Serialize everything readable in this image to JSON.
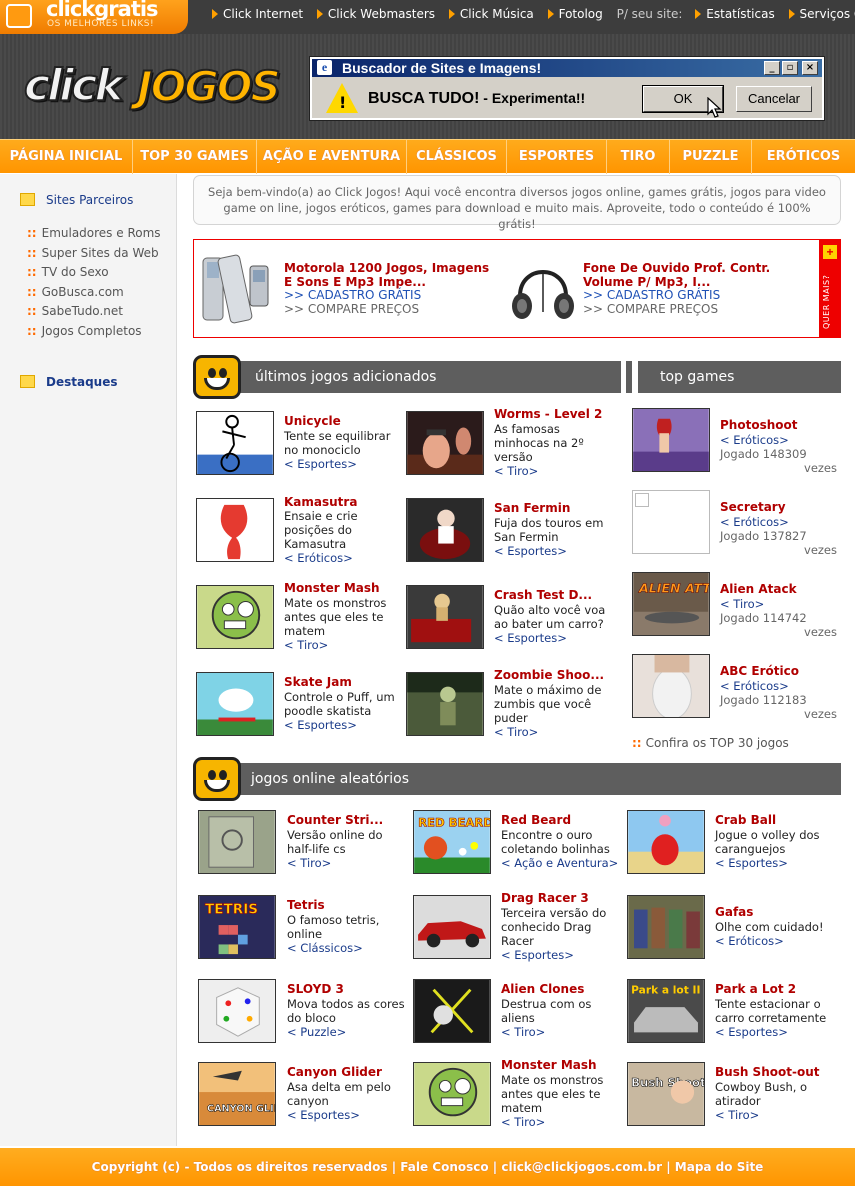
{
  "top_bar": {
    "brand_name": "clickgratis",
    "brand_tagline": "OS MELHORES LINKS!",
    "links": [
      "Click Internet",
      "Click Webmasters",
      "Click Música",
      "Fotolog"
    ],
    "site_label": "P/ seu site:",
    "site_links": [
      "Estatísticas",
      "Serviços Grátis"
    ]
  },
  "logo": {
    "part1": "click",
    "part2": "JOGOS"
  },
  "dialog": {
    "title": "Buscador de Sites e Imagens!",
    "message_bold": "BUSCA TUDO!",
    "message_rest": " - Experimenta!!",
    "ok_label": "OK",
    "cancel_label": "Cancelar",
    "minimize": "_",
    "maximize": "▫",
    "close": "×"
  },
  "main_nav": [
    "PÁGINA INICIAL",
    "TOP 30 GAMES",
    "AÇÃO E AVENTURA",
    "CLÁSSICOS",
    "ESPORTES",
    "TIRO",
    "PUZZLE",
    "ERÓTICOS"
  ],
  "sidebar": {
    "partners_title": "Sites Parceiros",
    "partners": [
      "Emuladores e Roms",
      "Super Sites da Web",
      "TV do Sexo",
      "GoBusca.com",
      "SabeTudo.net",
      "Jogos Completos"
    ],
    "highlights_title": "Destaques"
  },
  "welcome_text": "Seja bem-vindo(a) ao Click Jogos! Aqui você encontra diversos jogos online, games grátis, jogos para video game on line, jogos eróticos, games para download e muito mais. Aproveite, todo o conteúdo é 100% grátis!",
  "ad": {
    "items": [
      {
        "title": "Motorola 1200 Jogos, Imagens E Sons E Mp3 Impe...",
        "link1": ">> CADASTRO GRÁTIS",
        "link2": ">> COMPARE PREÇOS"
      },
      {
        "title": "Fone De Ouvido Prof. Contr. Volume P/ Mp3, I...",
        "link1": ">> CADASTRO GRÁTIS",
        "link2": ">> COMPARE PREÇOS"
      }
    ],
    "side_plus": "+",
    "side_label": "QUER MAIS?"
  },
  "latest": {
    "title": "últimos jogos adicionados",
    "games": [
      {
        "name": "Unicycle",
        "desc": [
          "Tente se equilibrar",
          "no monociclo"
        ],
        "cat": "< Esportes>"
      },
      {
        "name": "Worms - Level 2",
        "desc": [
          "As famosas",
          "minhocas na 2º",
          "versão"
        ],
        "cat": "< Tiro>"
      },
      {
        "name": "Kamasutra",
        "desc": [
          "Ensaie e crie",
          "posições do",
          "Kamasutra"
        ],
        "cat": "< Eróticos>"
      },
      {
        "name": "San Fermin",
        "desc": [
          "Fuja dos touros em",
          "San Fermin"
        ],
        "cat": "< Esportes>"
      },
      {
        "name": "Monster Mash",
        "desc": [
          "Mate os monstros",
          "antes que eles te",
          "matem"
        ],
        "cat": "< Tiro>"
      },
      {
        "name": "Crash Test D...",
        "desc": [
          "Quão alto você voa",
          "ao bater um carro?"
        ],
        "cat": "< Esportes>"
      },
      {
        "name": "Skate Jam",
        "desc": [
          "Controle o Puff, um",
          "poodle skatista"
        ],
        "cat": "< Esportes>"
      },
      {
        "name": "Zoombie Shoo...",
        "desc": [
          "Mate o máximo de",
          "zumbis que você",
          "puder"
        ],
        "cat": "< Tiro>"
      }
    ]
  },
  "top_games": {
    "title": "top games",
    "played_label": "Jogado",
    "times_label": "vezes",
    "games": [
      {
        "name": "Photoshoot",
        "cat": "< Eróticos>",
        "plays": "148309"
      },
      {
        "name": "Secretary",
        "cat": "< Eróticos>",
        "plays": "137827"
      },
      {
        "name": "Alien Atack",
        "cat": "< Tiro>",
        "plays": "114742"
      },
      {
        "name": "ABC Erótico",
        "cat": "< Eróticos>",
        "plays": "112183"
      }
    ],
    "more_link": "Confira os TOP 30 jogos"
  },
  "random": {
    "title": "jogos online aleatórios",
    "games": [
      {
        "name": "Counter Stri...",
        "desc": [
          "Versão online do",
          "half-life cs"
        ],
        "cat": "< Tiro>"
      },
      {
        "name": "Red Beard",
        "desc": [
          "Encontre o ouro",
          "coletando bolinhas"
        ],
        "cat": "< Ação e Aventura>"
      },
      {
        "name": "Crab Ball",
        "desc": [
          "Jogue o volley dos",
          "caranguejos"
        ],
        "cat": "< Esportes>"
      },
      {
        "name": "Tetris",
        "desc": [
          "O famoso tetris,",
          "online"
        ],
        "cat": "< Clássicos>"
      },
      {
        "name": "Drag Racer 3",
        "desc": [
          "Terceira versão do",
          "conhecido Drag",
          "Racer"
        ],
        "cat": "< Esportes>"
      },
      {
        "name": "Gafas",
        "desc": [
          "Olhe com cuidado!"
        ],
        "cat": "< Eróticos>"
      },
      {
        "name": "SLOYD 3",
        "desc": [
          "Mova todos as cores",
          "do bloco"
        ],
        "cat": "< Puzzle>"
      },
      {
        "name": "Alien Clones",
        "desc": [
          "Destrua com os",
          "aliens"
        ],
        "cat": "< Tiro>"
      },
      {
        "name": "Park a Lot 2",
        "desc": [
          "Tente estacionar o",
          "carro corretamente"
        ],
        "cat": "< Esportes>"
      },
      {
        "name": "Canyon Glider",
        "desc": [
          "Asa delta em pelo",
          "canyon"
        ],
        "cat": "< Esportes>"
      },
      {
        "name": "Monster Mash",
        "desc": [
          "Mate os monstros",
          "antes que eles te",
          "matem"
        ],
        "cat": "< Tiro>"
      },
      {
        "name": "Bush Shoot-out",
        "desc": [
          "Cowboy Bush, o",
          "atirador"
        ],
        "cat": "< Tiro>"
      }
    ],
    "thumb_text": {
      "red_beard": "RED BEARD",
      "tetris": "TETRIS",
      "park": "Park a lot II",
      "canyon": "CANYON GLIDER",
      "bush": "Bush Shoot-Out",
      "alien_attack": "ALIEN ATTACK"
    }
  },
  "footer": {
    "text": "Copyright (c) - Todos os direitos reservados | Fale Conosco | click@clickjogos.com.br | Mapa do Site"
  },
  "colors": {
    "orange": "#ff9a00",
    "dark_red": "#b00000",
    "link_blue": "#1a3b8a",
    "gray_header": "#5e5e5e"
  }
}
